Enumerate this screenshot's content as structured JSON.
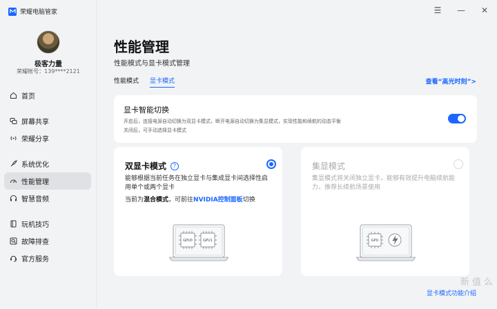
{
  "app": {
    "name": "荣耀电脑管家"
  },
  "user": {
    "name": "极客力量",
    "account": "荣耀帐号：139****2121"
  },
  "sidebar": {
    "items": [
      {
        "label": "首页",
        "icon": "home-icon"
      },
      {
        "label": "屏幕共享",
        "icon": "screen-share-icon"
      },
      {
        "label": "荣耀分享",
        "icon": "wireless-share-icon"
      },
      {
        "label": "系统优化",
        "icon": "rocket-icon"
      },
      {
        "label": "性能管理",
        "icon": "performance-gauge-icon",
        "active": true
      },
      {
        "label": "智慧音频",
        "icon": "headphones-icon"
      },
      {
        "label": "玩机技巧",
        "icon": "tips-book-icon"
      },
      {
        "label": "故障排查",
        "icon": "diagnose-icon"
      },
      {
        "label": "官方服务",
        "icon": "headset-service-icon"
      }
    ]
  },
  "window": {
    "menu": "☰",
    "minimize": "—",
    "close": "✕"
  },
  "page": {
    "title": "性能管理",
    "subtitle": "性能模式与显卡模式管理",
    "tabs": [
      {
        "label": "性能模式"
      },
      {
        "label": "显卡模式",
        "active": true
      }
    ],
    "highlight_link": "查看“高光时刻”>"
  },
  "gpu_switch": {
    "title": "显卡智能切换",
    "desc_line1": "开启后，连接电源自动切换为双显卡模式，断开电源自动切换为集显模式，实现性能和续航的动态平衡",
    "desc_line2": "关闭后，可手动选择显卡模式",
    "enabled": true
  },
  "dual_mode": {
    "title": "双显卡模式",
    "help": "?",
    "desc": "能够根据当前任务在独立显卡与集成显卡间选择性启用单个或两个显卡",
    "current_prefix": "当前为",
    "current_mode": "混合模式",
    "current_mid": "，可前往",
    "current_link": "NVIDIA控制面板",
    "current_suffix": "切换",
    "selected": true,
    "chip1": "GPU0",
    "chip2": "GPU1"
  },
  "igpu_mode": {
    "title": "集显模式",
    "desc": "集显模式将关闭独立显卡，能够有效提升电脑续航能力，推荐长续航场景使用",
    "selected": false,
    "chip": "GPU"
  },
  "footer": {
    "link": "显卡模式功能介绍"
  },
  "watermark": "新 值 么"
}
